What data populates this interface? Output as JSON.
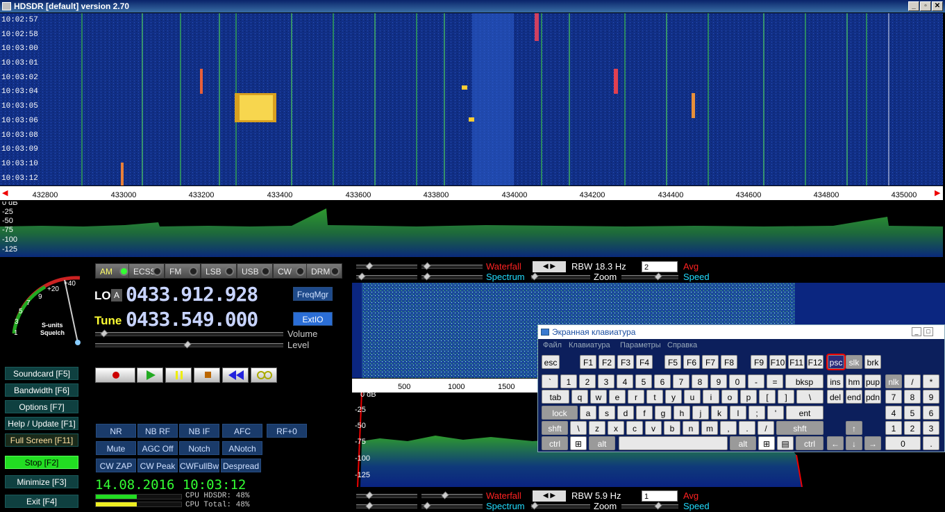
{
  "window": {
    "title": "HDSDR [default]  version 2.70",
    "buttons": [
      "_",
      "▫",
      "✕"
    ]
  },
  "waterfall": {
    "times": [
      "10:02:57",
      "10:02:58",
      "10:03:00",
      "10:03:01",
      "10:03:02",
      "10:03:04",
      "10:03:05",
      "10:03:06",
      "10:03:08",
      "10:03:09",
      "10:03:10",
      "10:03:12"
    ]
  },
  "freq_axis": {
    "ticks": [
      "432800",
      "433000",
      "433200",
      "433400",
      "433600",
      "433800",
      "434000",
      "434200",
      "434400",
      "434600",
      "434800",
      "435000"
    ]
  },
  "spectrum_top": {
    "db_labels": [
      "0 dB",
      "-25",
      "-50",
      "-75",
      "-100",
      "-125"
    ]
  },
  "smeter": {
    "scale": [
      "+40",
      "+20",
      "9",
      "7",
      "5",
      "3",
      "1"
    ],
    "label1": "S-units",
    "label2": "Squelch"
  },
  "modes": [
    {
      "label": "AM",
      "active": true
    },
    {
      "label": "ECSS",
      "active": false
    },
    {
      "label": "FM",
      "active": false
    },
    {
      "label": "LSB",
      "active": false
    },
    {
      "label": "USB",
      "active": false
    },
    {
      "label": "CW",
      "active": false
    },
    {
      "label": "DRM",
      "active": false
    }
  ],
  "lo": {
    "label": "LO",
    "sub": "A",
    "value": "0433.912.928",
    "btn": "FreqMgr"
  },
  "tune": {
    "label": "Tune",
    "value": "0433.549.000",
    "btn": "ExtIO"
  },
  "sliders": {
    "volume": "Volume",
    "level": "Level"
  },
  "fkeys": [
    {
      "label": "Soundcard  [F5]"
    },
    {
      "label": "Bandwidth  [F6]"
    },
    {
      "label": "Options  [F7]"
    },
    {
      "label": "Help / Update  [F1]"
    },
    {
      "label": "Full Screen  [F11]"
    },
    {
      "label": "Stop  [F2]"
    },
    {
      "label": "Minimize  [F3]"
    },
    {
      "label": "Exit  [F4]"
    }
  ],
  "dsp_buttons": [
    "NR",
    "NB RF",
    "NB IF",
    "AFC",
    "RF+0",
    "Mute",
    "AGC Off",
    "Notch",
    "ANotch",
    "CW ZAP",
    "CW Peak",
    "CWFullBw",
    "Despread"
  ],
  "datetime": "14.08.2016 10:03:12",
  "cpu": {
    "hdsdr": "CPU HDSDR:  48%",
    "total": "CPU Total:  48%",
    "hdsdr_pct": 48,
    "total_pct": 48
  },
  "audio_panel": {
    "waterfall": "Waterfall",
    "spectrum": "Spectrum",
    "zoom": "Zoom",
    "speed": "Speed",
    "avg": "Avg",
    "rbw_top": "RBW  18.3 Hz",
    "avg_top": "2",
    "rbw_bottom": "RBW   5.9 Hz",
    "avg_bottom": "1",
    "axis": [
      "500",
      "1000",
      "1500"
    ],
    "db_labels": [
      "0 dB",
      "-25",
      "-50",
      "-75",
      "-100",
      "-125"
    ]
  },
  "osk": {
    "title": "Экранная клавиатура",
    "menu": [
      "Файл",
      "Клавиатура",
      "Параметры",
      "Справка"
    ],
    "row0": [
      "esc",
      "F1",
      "F2",
      "F3",
      "F4",
      "F5",
      "F6",
      "F7",
      "F8",
      "F9",
      "F10",
      "F11",
      "F12",
      "psc",
      "slk",
      "brk"
    ],
    "row1": [
      "`",
      "1",
      "2",
      "3",
      "4",
      "5",
      "6",
      "7",
      "8",
      "9",
      "0",
      "-",
      "=",
      "bksp",
      "ins",
      "hm",
      "pup",
      "nlk",
      "/",
      "*",
      "-"
    ],
    "row2": [
      "tab",
      "q",
      "w",
      "e",
      "r",
      "t",
      "y",
      "u",
      "i",
      "o",
      "p",
      "[",
      "]",
      "\\",
      "del",
      "end",
      "pdn",
      "7",
      "8",
      "9"
    ],
    "row3": [
      "lock",
      "a",
      "s",
      "d",
      "f",
      "g",
      "h",
      "j",
      "k",
      "l",
      ";",
      "'",
      "ent",
      "4",
      "5",
      "6",
      "+"
    ],
    "row4": [
      "shft",
      "\\",
      "z",
      "x",
      "c",
      "v",
      "b",
      "n",
      "m",
      ",",
      ".",
      "/",
      "shft",
      "↑",
      "1",
      "2",
      "3"
    ],
    "row5": [
      "ctrl",
      "alt",
      "alt",
      "ctrl",
      "←",
      "↓",
      "→",
      "0",
      "."
    ]
  }
}
